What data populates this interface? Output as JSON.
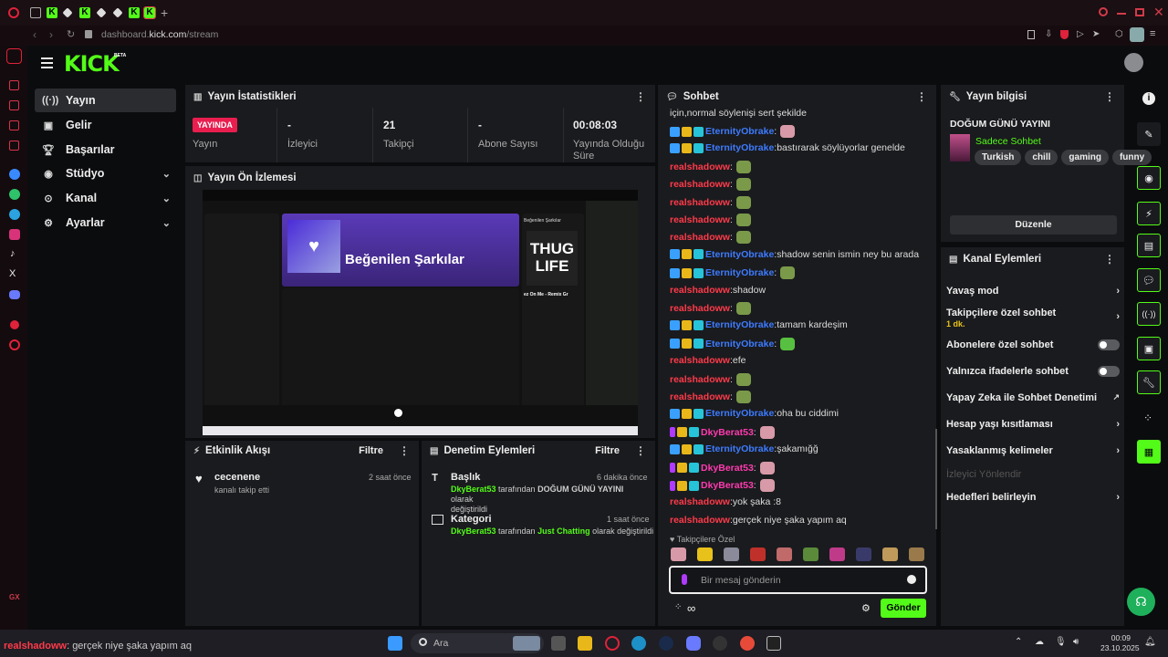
{
  "browser": {
    "url_prefix": "dashboard.",
    "url_domain": "kick.com",
    "url_path": "/stream"
  },
  "app": {
    "logo": "KICK",
    "logo_badge": "BETA"
  },
  "sidebar": {
    "items": [
      {
        "label": "Yayın",
        "icon": "broadcast-icon"
      },
      {
        "label": "Gelir",
        "icon": "money-icon"
      },
      {
        "label": "Başarılar",
        "icon": "trophy-icon"
      },
      {
        "label": "Stüdyo",
        "icon": "studio-icon"
      },
      {
        "label": "Kanal",
        "icon": "channel-icon"
      },
      {
        "label": "Ayarlar",
        "icon": "gear-icon"
      }
    ]
  },
  "stats": {
    "title": "Yayın İstatistikleri",
    "live_badge": "YAYINDA",
    "live_label": "Yayın",
    "viewers_value": "-",
    "viewers_label": "İzleyici",
    "followers_value": "21",
    "followers_label": "Takipçi",
    "subs_value": "-",
    "subs_label": "Abone Sayısı",
    "duration_value": "00:08:03",
    "duration_label_1": "Yayında Olduğu",
    "duration_label_2": "Süre"
  },
  "preview": {
    "title": "Yayın Ön İzlemesi",
    "playlist_title": "Beğenilen Şarkılar",
    "side_title": "Beğenilen Şarkılar",
    "album_text_1": "THUG",
    "album_text_2": "LIFE",
    "now_playing": "ez On Me - Remix Gr"
  },
  "activity": {
    "title": "Etkinlik Akışı",
    "filter": "Filtre",
    "item_user": "cecenene",
    "item_desc": "kanalı takip etti",
    "item_time": "2 saat önce"
  },
  "moderation": {
    "title": "Denetim Eylemleri",
    "filter": "Filtre",
    "items": [
      {
        "title": "Başlık",
        "time": "6 dakika önce",
        "user": "DkyBerat53",
        "mid": " tarafından ",
        "value": "DOĞUM GÜNÜ YAYINI",
        "suffix": " olarak",
        "line2": "değiştirildi"
      },
      {
        "title": "Kategori",
        "time": "1 saat önce",
        "user": "DkyBerat53",
        "mid": " tarafından ",
        "value": "Just Chatting",
        "suffix": " olarak değiştirildi",
        "line2": ""
      }
    ]
  },
  "chat": {
    "title": "Sohbet",
    "top_text": "için,normal söylenişi sert şekilde",
    "messages": [
      {
        "user": "EternityObrake",
        "color": "blue",
        "text": "",
        "emote": "pink"
      },
      {
        "user": "EternityObrake",
        "color": "blue",
        "text": "bastırarak söylüyorlar genelde",
        "emote": ""
      },
      {
        "user": "realshadoww",
        "color": "red",
        "text": "",
        "emote": "green"
      },
      {
        "user": "realshadoww",
        "color": "red",
        "text": "",
        "emote": "green"
      },
      {
        "user": "realshadoww",
        "color": "red",
        "text": "",
        "emote": "green"
      },
      {
        "user": "realshadoww",
        "color": "red",
        "text": "",
        "emote": "green"
      },
      {
        "user": "realshadoww",
        "color": "red",
        "text": "",
        "emote": "green"
      },
      {
        "user": "EternityObrake",
        "color": "blue",
        "text": "shadow senin ismin ney bu arada",
        "emote": ""
      },
      {
        "user": "EternityObrake",
        "color": "blue",
        "text": "",
        "emote": "green"
      },
      {
        "user": "realshadoww",
        "color": "red",
        "text": "shadow",
        "emote": ""
      },
      {
        "user": "realshadoww",
        "color": "red",
        "text": "",
        "emote": "green"
      },
      {
        "user": "EternityObrake",
        "color": "blue",
        "text": "tamam kardeşim",
        "emote": ""
      },
      {
        "user": "EternityObrake",
        "color": "blue",
        "text": "",
        "emote": "frog"
      },
      {
        "user": "realshadoww",
        "color": "red",
        "text": "efe",
        "emote": ""
      },
      {
        "user": "realshadoww",
        "color": "red",
        "text": "",
        "emote": "green"
      },
      {
        "user": "realshadoww",
        "color": "red",
        "text": "",
        "emote": "green"
      },
      {
        "user": "EternityObrake",
        "color": "blue",
        "text": "oha bu ciddimi",
        "emote": ""
      },
      {
        "user": "DkyBerat53",
        "color": "pink",
        "text": "",
        "emote": "pink"
      },
      {
        "user": "EternityObrake",
        "color": "blue",
        "text": "şakamığğ",
        "emote": ""
      },
      {
        "user": "DkyBerat53",
        "color": "pink",
        "text": "",
        "emote": "pink"
      },
      {
        "user": "DkyBerat53",
        "color": "pink",
        "text": "",
        "emote": "pink"
      },
      {
        "user": "realshadoww",
        "color": "red",
        "text": "yok şaka :8",
        "emote": ""
      },
      {
        "user": "realshadoww",
        "color": "red",
        "text": "gerçek niye şaka yapım aq",
        "emote": ""
      }
    ],
    "followers_only_label": "Takipçilere Özel",
    "input_placeholder": "Bir mesaj gönderin",
    "send_label": "Gönder"
  },
  "stream_info": {
    "title": "Yayın bilgisi",
    "stream_title": "DOĞUM GÜNÜ YAYINI",
    "category": "Sadece Sohbet",
    "tags": [
      "Turkish",
      "chill",
      "gaming",
      "funny"
    ],
    "edit_label": "Düzenle"
  },
  "channel_actions": {
    "title": "Kanal Eylemleri",
    "items": [
      {
        "label": "Yavaş mod",
        "type": "chevron"
      },
      {
        "label": "Takipçilere özel sohbet",
        "sub": "1 dk.",
        "type": "chevron"
      },
      {
        "label": "Abonelere özel sohbet",
        "type": "toggle"
      },
      {
        "label": "Yalnızca ifadelerle sohbet",
        "type": "toggle"
      },
      {
        "label": "Yapay Zeka ile Sohbet Denetimi",
        "type": "external"
      },
      {
        "label": "Hesap yaşı kısıtlaması",
        "type": "chevron"
      },
      {
        "label": "Yasaklanmış kelimeler",
        "type": "chevron"
      },
      {
        "label": "İzleyici Yönlendir",
        "type": "disabled"
      },
      {
        "label": "Hedefleri belirleyin",
        "type": "chevron"
      }
    ]
  },
  "taskbar": {
    "overlay_user": "realshadoww",
    "overlay_text": ": gerçek niye şaka yapım aq",
    "search_label": "Ara",
    "time": "00:09",
    "date": "23.10.2025"
  },
  "colors": {
    "brand": "#53fc18",
    "live": "#e91e4f",
    "panel": "#1a1b1e"
  }
}
